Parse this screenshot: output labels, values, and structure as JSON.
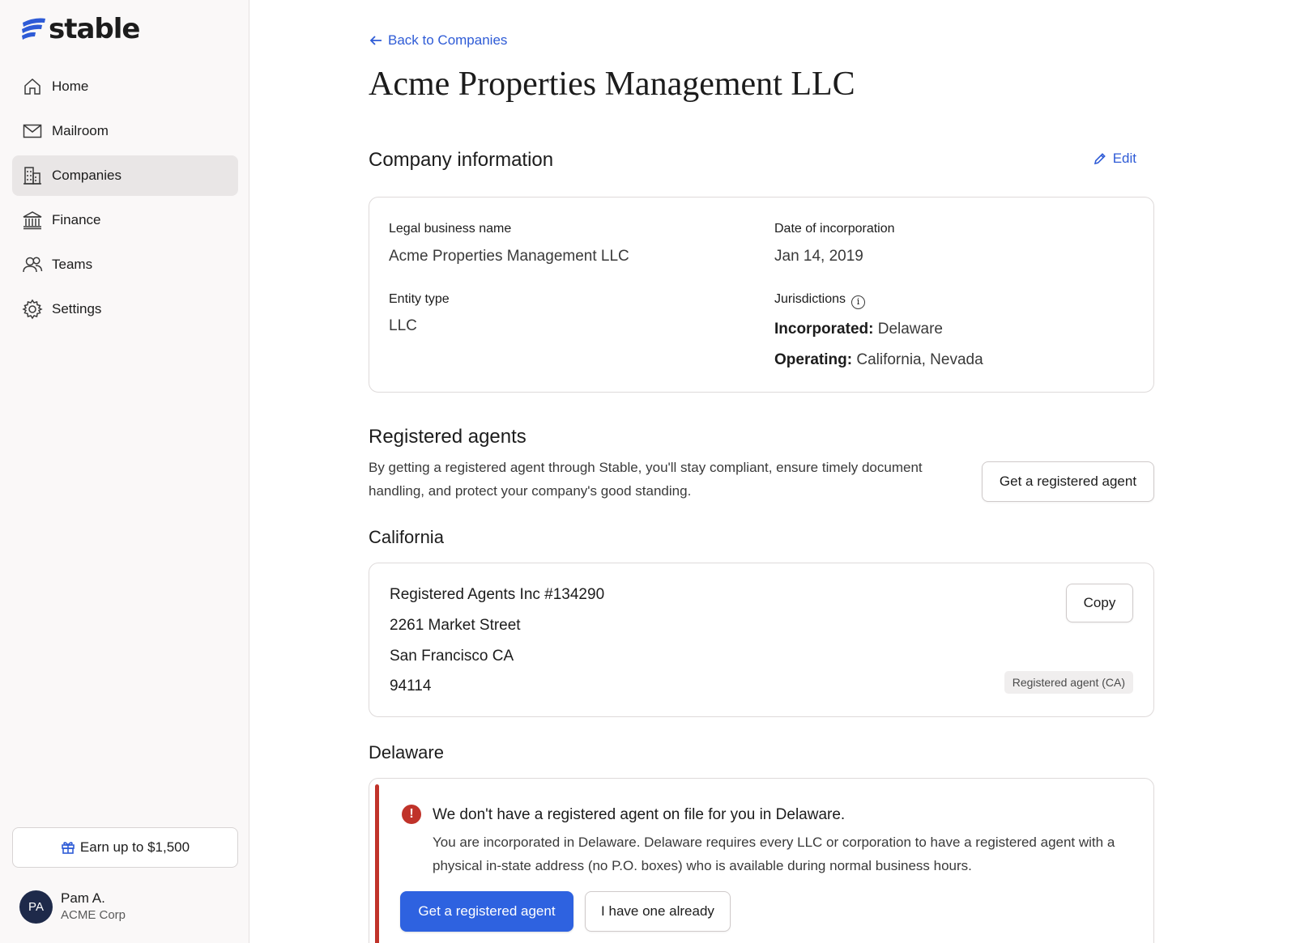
{
  "brand": {
    "name": "stable",
    "accent": "#2e5bd6"
  },
  "sidebar": {
    "items": [
      {
        "label": "Home",
        "icon": "home-icon"
      },
      {
        "label": "Mailroom",
        "icon": "mail-icon"
      },
      {
        "label": "Companies",
        "icon": "building-icon",
        "active": true
      },
      {
        "label": "Finance",
        "icon": "bank-icon"
      },
      {
        "label": "Teams",
        "icon": "users-icon"
      },
      {
        "label": "Settings",
        "icon": "gear-icon"
      }
    ],
    "earn_label": "Earn up to $1,500",
    "user": {
      "initials": "PA",
      "name": "Pam A.",
      "org": "ACME Corp"
    }
  },
  "main": {
    "back_label": "Back to Companies",
    "title": "Acme Properties Management LLC",
    "company_info": {
      "heading": "Company information",
      "edit_label": "Edit",
      "legal_name_label": "Legal business name",
      "legal_name_value": "Acme Properties Management LLC",
      "incorp_date_label": "Date of incorporation",
      "incorp_date_value": "Jan 14, 2019",
      "entity_type_label": "Entity type",
      "entity_type_value": "LLC",
      "jurisdictions_label": "Jurisdictions",
      "incorporated_label": "Incorporated:",
      "incorporated_value": "Delaware",
      "operating_label": "Operating:",
      "operating_value": "California, Nevada"
    },
    "registered_agents": {
      "heading": "Registered agents",
      "description": "By getting a registered agent through Stable, you'll stay compliant, ensure timely document handling, and protect your company's good standing.",
      "cta_label": "Get a registered agent"
    },
    "california": {
      "heading": "California",
      "agent_name": "Registered Agents Inc #134290",
      "street": "2261 Market Street",
      "city": "San Francisco CA",
      "zip": "94114",
      "copy_label": "Copy",
      "badge": "Registered agent (CA)"
    },
    "delaware": {
      "heading": "Delaware",
      "alert_title": "We don't have a registered agent on file for you in Delaware.",
      "alert_body": "You are incorporated in Delaware. Delaware requires every LLC or corporation to have a registered agent with a physical in-state address (no P.O. boxes) who is available during normal business hours.",
      "primary_label": "Get a registered agent",
      "secondary_label": "I have one already",
      "alert_color": "#c0332a"
    }
  }
}
